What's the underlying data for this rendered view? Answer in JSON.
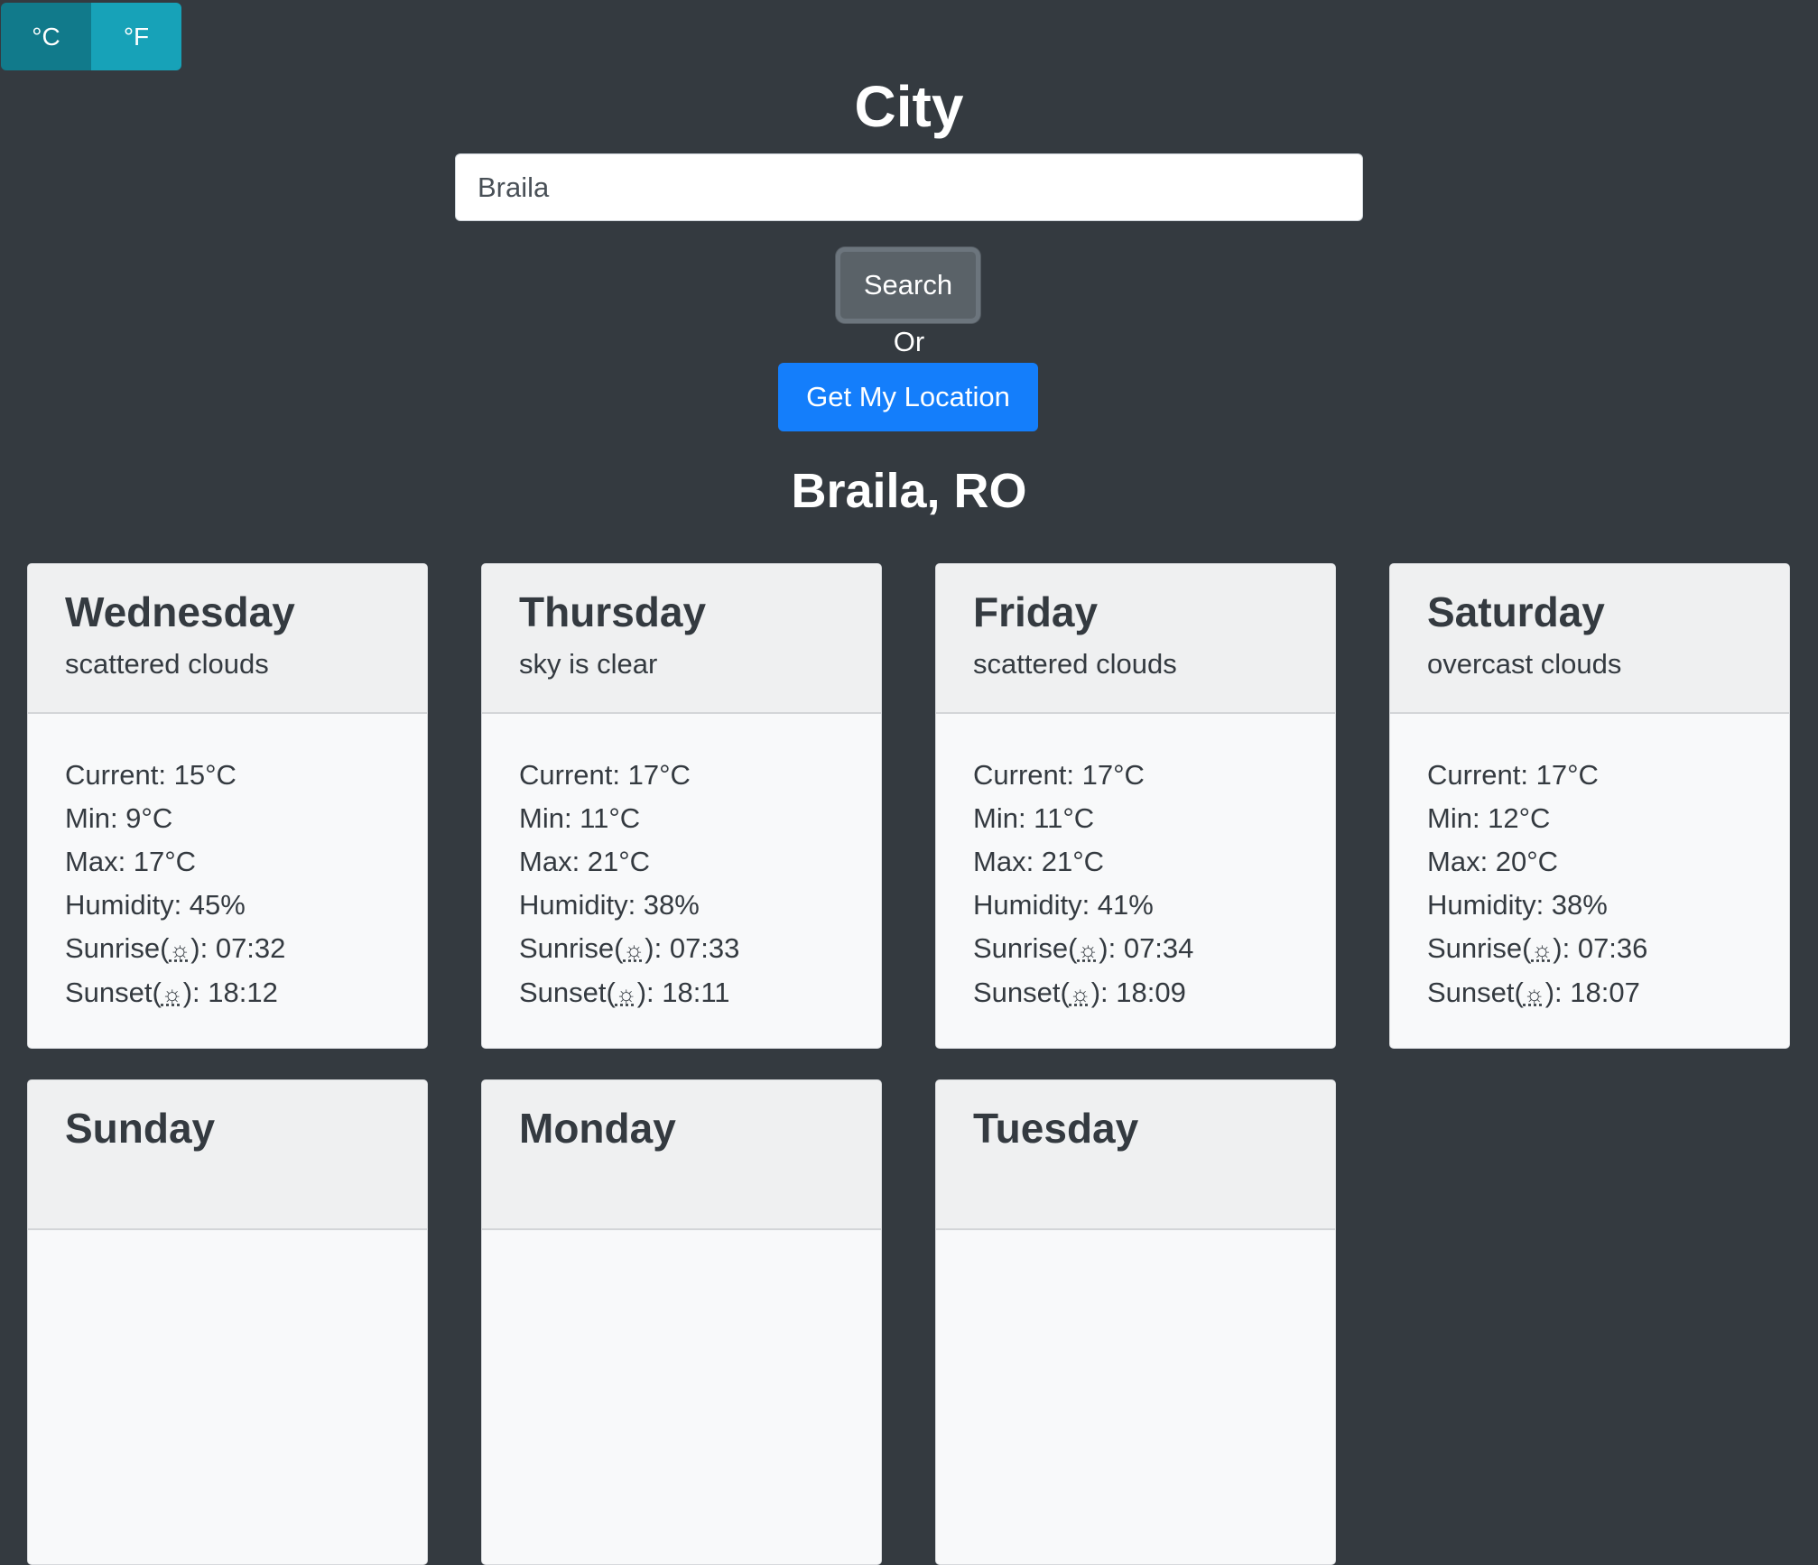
{
  "units": {
    "celsius_label": "°C",
    "fahrenheit_label": "°F"
  },
  "page_title": "City",
  "search": {
    "value": "Braila",
    "button_label": "Search"
  },
  "or_label": "Or",
  "location_button_label": "Get My Location",
  "location_title": "Braila, RO",
  "forecast": [
    {
      "day": "Wednesday",
      "description": "scattered clouds",
      "current": "Current:  15°C",
      "min": "Min:  9°C",
      "max": "Max:  17°C",
      "humidity": "Humidity:  45%",
      "sunrise_label": "Sunrise(",
      "sunrise_value": "): 07:32",
      "sunset_label": "Sunset(",
      "sunset_value": "): 18:12"
    },
    {
      "day": "Thursday",
      "description": "sky is clear",
      "current": "Current:  17°C",
      "min": "Min:  11°C",
      "max": "Max:  21°C",
      "humidity": "Humidity:  38%",
      "sunrise_label": "Sunrise(",
      "sunrise_value": "): 07:33",
      "sunset_label": "Sunset(",
      "sunset_value": "): 18:11"
    },
    {
      "day": "Friday",
      "description": "scattered clouds",
      "current": "Current:  17°C",
      "min": "Min:  11°C",
      "max": "Max:  21°C",
      "humidity": "Humidity:  41%",
      "sunrise_label": "Sunrise(",
      "sunrise_value": "): 07:34",
      "sunset_label": "Sunset(",
      "sunset_value": "): 18:09"
    },
    {
      "day": "Saturday",
      "description": "overcast clouds",
      "current": "Current:  17°C",
      "min": "Min:  12°C",
      "max": "Max:  20°C",
      "humidity": "Humidity:  38%",
      "sunrise_label": "Sunrise(",
      "sunrise_value": "): 07:36",
      "sunset_label": "Sunset(",
      "sunset_value": "): 18:07"
    },
    {
      "day": "Sunday"
    },
    {
      "day": "Monday"
    },
    {
      "day": "Tuesday"
    }
  ],
  "icons": {
    "sunrise": "sunrise-icon",
    "sunset": "sunset-icon"
  },
  "colors": {
    "background": "#343a40",
    "primary": "#147efb",
    "info": "#17a2b8",
    "info_active": "#117a8b",
    "secondary": "#5a6268"
  }
}
